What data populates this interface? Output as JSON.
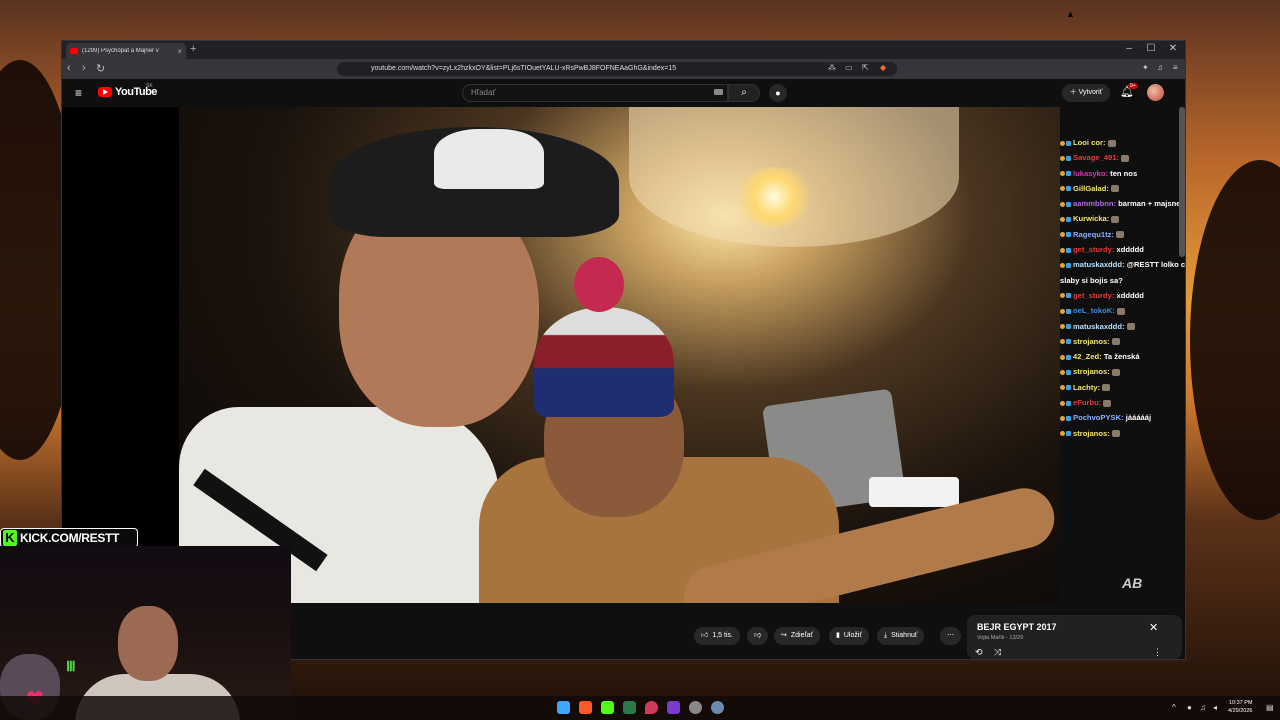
{
  "browser": {
    "tab_title": "(1299) Psychopat a Majner v",
    "new_tab": "+",
    "url": "youtube.com/watch?v=zyLx2hzkxOY&list=PLj6sTIOuetYALU-xRsPwBJ8FOFNEAaGhG&index=15",
    "minimize": "–",
    "maximize": "☐",
    "close": "✕"
  },
  "youtube": {
    "logo_text": "YouTube",
    "country_code": "SK",
    "search_placeholder": "Hľadať",
    "create_label": "Vytvoriť",
    "notification_count": "9+"
  },
  "chat": {
    "messages": [
      {
        "user": "Looi cor:",
        "text": "",
        "color": "#f5e66a"
      },
      {
        "user": "Savage_491:",
        "text": "",
        "color": "#e23b3b"
      },
      {
        "user": "lukasyko:",
        "text": "ten nos",
        "color": "#d23bb0"
      },
      {
        "user": "GillGalad:",
        "text": "",
        "color": "#f5e66a"
      },
      {
        "user": "aammbbnn:",
        "text": "barman + majsner = VL",
        "color": "#b06ae0"
      },
      {
        "user": "Kurwicka:",
        "text": "",
        "color": "#f5e66a"
      },
      {
        "user": "Ragequ1tz:",
        "text": "",
        "color": "#8ab0ff"
      },
      {
        "user": "get_sturdy:",
        "text": "xddddd",
        "color": "#e23b3b"
      },
      {
        "user": "matuskaxddd:",
        "text": "@RESTT lolko co?",
        "color": "#b8e0ff"
      },
      {
        "user": "",
        "text": "slaby si bojis sa?",
        "color": "#ffffff"
      },
      {
        "user": "get_sturdy:",
        "text": "xddddd",
        "color": "#e23b3b"
      },
      {
        "user": "oeL_tokoK:",
        "text": "",
        "color": "#3a8ae0"
      },
      {
        "user": "matuskaxddd:",
        "text": "",
        "color": "#b8e0ff"
      },
      {
        "user": "strojanos:",
        "text": "",
        "color": "#f5e66a"
      },
      {
        "user": "42_Zed:",
        "text": "Ta ženská",
        "color": "#f5e66a"
      },
      {
        "user": "strojanos:",
        "text": "",
        "color": "#f5e66a"
      },
      {
        "user": "Lachty:",
        "text": "",
        "color": "#f5e66a"
      },
      {
        "user": "eFurbu:",
        "text": "",
        "color": "#e23b3b"
      },
      {
        "user": "PochvoPYSK:",
        "text": "jáááááj",
        "color": "#8ab0ff"
      },
      {
        "user": "strojanos:",
        "text": "",
        "color": "#f5e66a"
      }
    ]
  },
  "actions": {
    "like_count": "1,5 tis.",
    "share": "Zdieľať",
    "save": "Uložiť",
    "download": "Stiahnuť",
    "more": "⋯"
  },
  "miniplaylist": {
    "title": "BEJR EGYPT 2017",
    "subtitle": "Vojta Mařík - 13/29"
  },
  "stream_overlay": {
    "kick_letter": "K",
    "kick_text": "KICK.COM/RESTT",
    "watermark_logo": "AB"
  },
  "taskbar": {
    "time": "10:37 PM",
    "date": "4/29/2026"
  },
  "colors": {
    "youtube_red": "#ff0000",
    "kick_green": "#53fc18",
    "yt_bg": "#0f0f0f"
  }
}
